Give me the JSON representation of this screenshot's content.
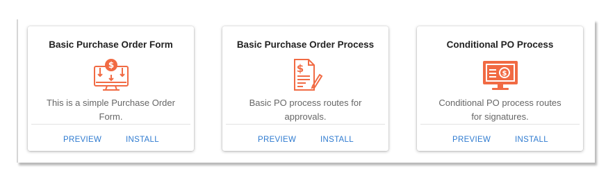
{
  "accent_color": "#f16a43",
  "link_color": "#2f7bd0",
  "cards": [
    {
      "title": "Basic Purchase Order Form",
      "description": "This is a simple Purchase Order Form.",
      "icon": "monitor-dollar-icon",
      "preview_label": "PREVIEW",
      "install_label": "INSTALL"
    },
    {
      "title": "Basic Purchase Order Process",
      "description": "Basic PO process routes for approvals.",
      "icon": "document-pen-dollar-icon",
      "preview_label": "PREVIEW",
      "install_label": "INSTALL"
    },
    {
      "title": "Conditional PO Process",
      "description": "Conditional PO process routes for signatures.",
      "icon": "screen-dollar-icon",
      "preview_label": "PREVIEW",
      "install_label": "INSTALL"
    }
  ]
}
